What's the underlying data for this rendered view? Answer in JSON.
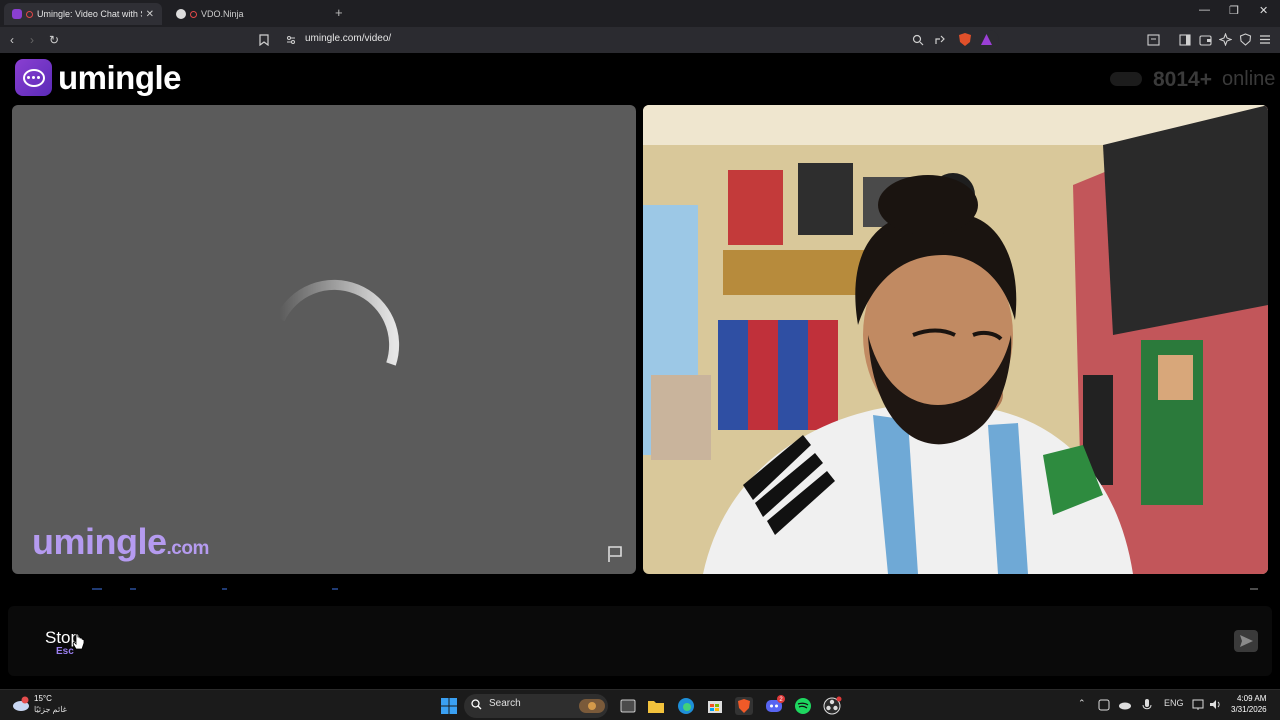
{
  "browser": {
    "tabs": [
      {
        "title": "Umingle: Video Chat with Str",
        "active": true
      },
      {
        "title": "VDO.Ninja",
        "active": false
      }
    ],
    "new_tab_symbol": "+",
    "url": "umingle.com/video/"
  },
  "site": {
    "logo_text": "umingle",
    "online_count": "8014+",
    "online_label": "online",
    "watermark_main": "umingle",
    "watermark_suffix": ".com",
    "brand_color": "#7b3fe4"
  },
  "controls": {
    "stop_label": "Stop",
    "stop_shortcut": "Esc",
    "chat_placeholder": ""
  },
  "taskbar": {
    "weather_temp": "15°C",
    "weather_desc": "غائم جزئيًا",
    "search_label": "Search",
    "lang": "ENG",
    "time": "4:09 AM",
    "date": "3/31/2026",
    "discord_badge": "2"
  }
}
